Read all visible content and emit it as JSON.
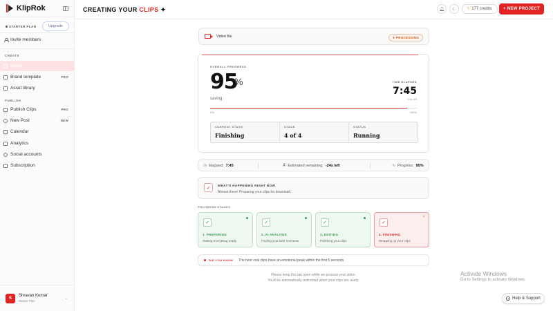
{
  "brand": {
    "name": "KlipRok"
  },
  "sidebar": {
    "plan_label": "STARTER PLAN",
    "upgrade_label": "Upgrade",
    "invite_label": "Invite members",
    "section_create": "CREATE",
    "section_publish": "PUBLISH",
    "items": [
      {
        "label": "Home",
        "tag": ""
      },
      {
        "label": "Brand template",
        "tag": "PRO"
      },
      {
        "label": "Asset library",
        "tag": ""
      },
      {
        "label": "Publish Clips",
        "tag": "PRO"
      },
      {
        "label": "New Post",
        "tag": "NEW"
      },
      {
        "label": "Calendar",
        "tag": ""
      },
      {
        "label": "Analytics",
        "tag": ""
      },
      {
        "label": "Social accounts",
        "tag": ""
      },
      {
        "label": "Subscription",
        "tag": ""
      }
    ],
    "user": {
      "initial": "S",
      "name": "Shravan Kumar",
      "plan": "Starter Plan"
    }
  },
  "header": {
    "title_prefix": "CREATING YOUR",
    "title_accent": "CLIPS",
    "title_suffix": "✦",
    "credits": "177 credits",
    "new_project": "+ NEW PROJECT"
  },
  "video": {
    "label": "Video file",
    "status": "PROCESSING"
  },
  "progress": {
    "overall_label": "OVERALL PROGRESS",
    "percent": "95",
    "percent_sign": "%",
    "percent_value": 95,
    "status_text": "saving",
    "time_label": "TIME ELAPSED",
    "time_value": "7:45",
    "time_left": "~24s left",
    "bar_min": "0%",
    "bar_max": "100%",
    "current_stage_label": "CURRENT STAGE",
    "current_stage_value": "Finishing",
    "stage_label": "STAGE",
    "stage_value": "4 of 4",
    "status_label": "STATUS",
    "status_value": "Running"
  },
  "stats": {
    "elapsed_label": "Elapsed:",
    "elapsed_value": "7:45",
    "remaining_label": "Estimated remaining:",
    "remaining_value": "-24s left",
    "progress_label": "Progress:",
    "progress_value": "95%"
  },
  "happening": {
    "title": "WHAT'S HAPPENING RIGHT NOW",
    "subtitle": "Almost there! Preparing your clips for download."
  },
  "stages_label": "PROGRESS STAGES",
  "stages": [
    {
      "name": "1. PREPARING",
      "desc": "Getting everything ready"
    },
    {
      "name": "2. AI ANALYSIS",
      "desc": "Finding your best moments"
    },
    {
      "name": "3. EDITING",
      "desc": "Polishing your clips"
    },
    {
      "name": "4. FINISHING",
      "desc": "Wrapping up your clips"
    }
  ],
  "tip": {
    "label": "DID YOU KNOW",
    "text": "The best viral clips have an emotional peak within the first 5 seconds."
  },
  "footnote": {
    "line1": "Please keep this tab open while we process your video.",
    "line2": "You'll be automatically redirected when your clips are ready."
  },
  "watermark": {
    "title": "Activate Windows",
    "subtitle": "Go to Settings to activate Windows."
  },
  "help_label": "Help & Support",
  "colors": {
    "accent": "#e02424",
    "success": "#2f9a4e"
  }
}
